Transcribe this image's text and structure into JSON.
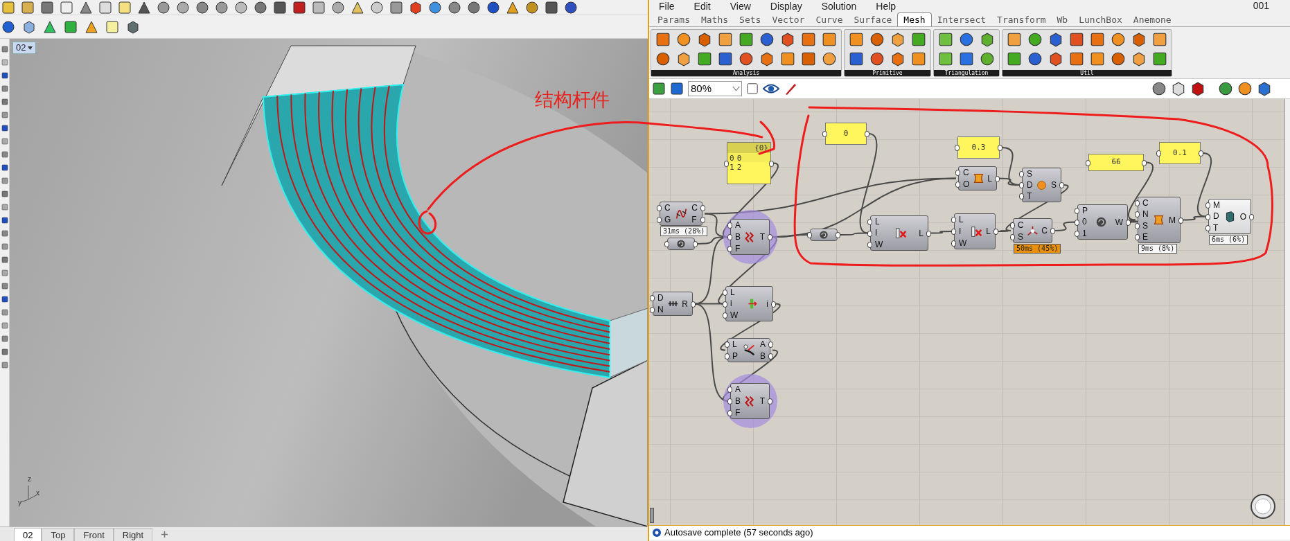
{
  "rhino": {
    "viewport": {
      "label": "02",
      "annotation": "结构杆件",
      "axes": [
        "x",
        "y",
        "z"
      ]
    },
    "viewport_tabs": [
      {
        "label": "02",
        "selected": true
      },
      {
        "label": "Top",
        "selected": false
      },
      {
        "label": "Front",
        "selected": false
      },
      {
        "label": "Right",
        "selected": false
      }
    ]
  },
  "grasshopper": {
    "menu": [
      "File",
      "Edit",
      "View",
      "Display",
      "Solution",
      "Help"
    ],
    "document_name": "001",
    "tabs": [
      {
        "label": "Params",
        "selected": false
      },
      {
        "label": "Maths",
        "selected": false
      },
      {
        "label": "Sets",
        "selected": false
      },
      {
        "label": "Vector",
        "selected": false
      },
      {
        "label": "Curve",
        "selected": false
      },
      {
        "label": "Surface",
        "selected": false
      },
      {
        "label": "Mesh",
        "selected": true
      },
      {
        "label": "Intersect",
        "selected": false
      },
      {
        "label": "Transform",
        "selected": false
      },
      {
        "label": "Wb",
        "selected": false
      },
      {
        "label": "LunchBox",
        "selected": false
      },
      {
        "label": "Anemone",
        "selected": false
      }
    ],
    "ribbon_groups": [
      "Analysis",
      "Primitive",
      "Triangulation",
      "Util"
    ],
    "zoom": "80%",
    "nodes": [
      {
        "kind": "list_panel",
        "header": "{0}",
        "rows": [
          {
            "index": "0",
            "value": "0"
          },
          {
            "index": "1",
            "value": "2"
          }
        ]
      },
      {
        "kind": "value_panel",
        "value": "0"
      },
      {
        "kind": "value_panel",
        "value": "0.3"
      },
      {
        "kind": "value_panel",
        "value": "66"
      },
      {
        "kind": "value_panel",
        "value": "0.1"
      },
      {
        "kind": "component",
        "inputs": [
          "C",
          "G"
        ],
        "outputs": [
          "C",
          "F"
        ],
        "timing": "31ms (28%)",
        "slow": false,
        "highlighted": false,
        "preview": true
      },
      {
        "kind": "relay"
      },
      {
        "kind": "component",
        "inputs": [
          "A",
          "B",
          "F"
        ],
        "outputs": [
          "T"
        ],
        "highlighted": true,
        "preview": true
      },
      {
        "kind": "relay"
      },
      {
        "kind": "component",
        "inputs": [
          "C",
          "O"
        ],
        "outputs": [
          "L"
        ],
        "highlighted": false,
        "preview": true
      },
      {
        "kind": "component",
        "inputs": [
          "S",
          "D",
          "T"
        ],
        "outputs": [
          "S"
        ],
        "highlighted": false,
        "preview": true
      },
      {
        "kind": "component",
        "inputs": [
          "L",
          "I",
          "W"
        ],
        "outputs": [
          "L"
        ],
        "highlighted": false,
        "preview": true
      },
      {
        "kind": "component",
        "inputs": [
          "L",
          "I",
          "W"
        ],
        "outputs": [
          "L"
        ],
        "highlighted": false,
        "preview": true
      },
      {
        "kind": "component",
        "inputs": [
          "C",
          "S"
        ],
        "outputs": [
          "C"
        ],
        "timing": "50ms (45%)",
        "slow": true,
        "highlighted": false,
        "preview": true
      },
      {
        "kind": "component",
        "inputs": [
          "P",
          "0",
          "1"
        ],
        "outputs": [
          "W"
        ],
        "highlighted": false,
        "preview": true
      },
      {
        "kind": "component",
        "inputs": [
          "C",
          "N",
          "S",
          "E"
        ],
        "outputs": [
          "M"
        ],
        "timing": "9ms (8%)",
        "slow": false,
        "highlighted": false,
        "preview": true
      },
      {
        "kind": "component",
        "inputs": [
          "M",
          "D",
          "T"
        ],
        "outputs": [
          "O"
        ],
        "timing": "6ms (6%)",
        "slow": false,
        "highlighted": false,
        "preview": false
      },
      {
        "kind": "component",
        "inputs": [
          "D",
          "N"
        ],
        "outputs": [
          "R"
        ],
        "highlighted": false,
        "preview": true
      },
      {
        "kind": "component",
        "inputs": [
          "L",
          "i",
          "W"
        ],
        "outputs": [
          "i"
        ],
        "highlighted": false,
        "preview": true
      },
      {
        "kind": "component",
        "inputs": [
          "L",
          "P"
        ],
        "outputs": [
          "A",
          "B"
        ],
        "highlighted": false,
        "preview": true
      },
      {
        "kind": "component",
        "inputs": [
          "A",
          "B",
          "F"
        ],
        "outputs": [
          "T"
        ],
        "highlighted": true,
        "preview": true
      }
    ],
    "status": "Autosave complete (57 seconds ago)"
  }
}
